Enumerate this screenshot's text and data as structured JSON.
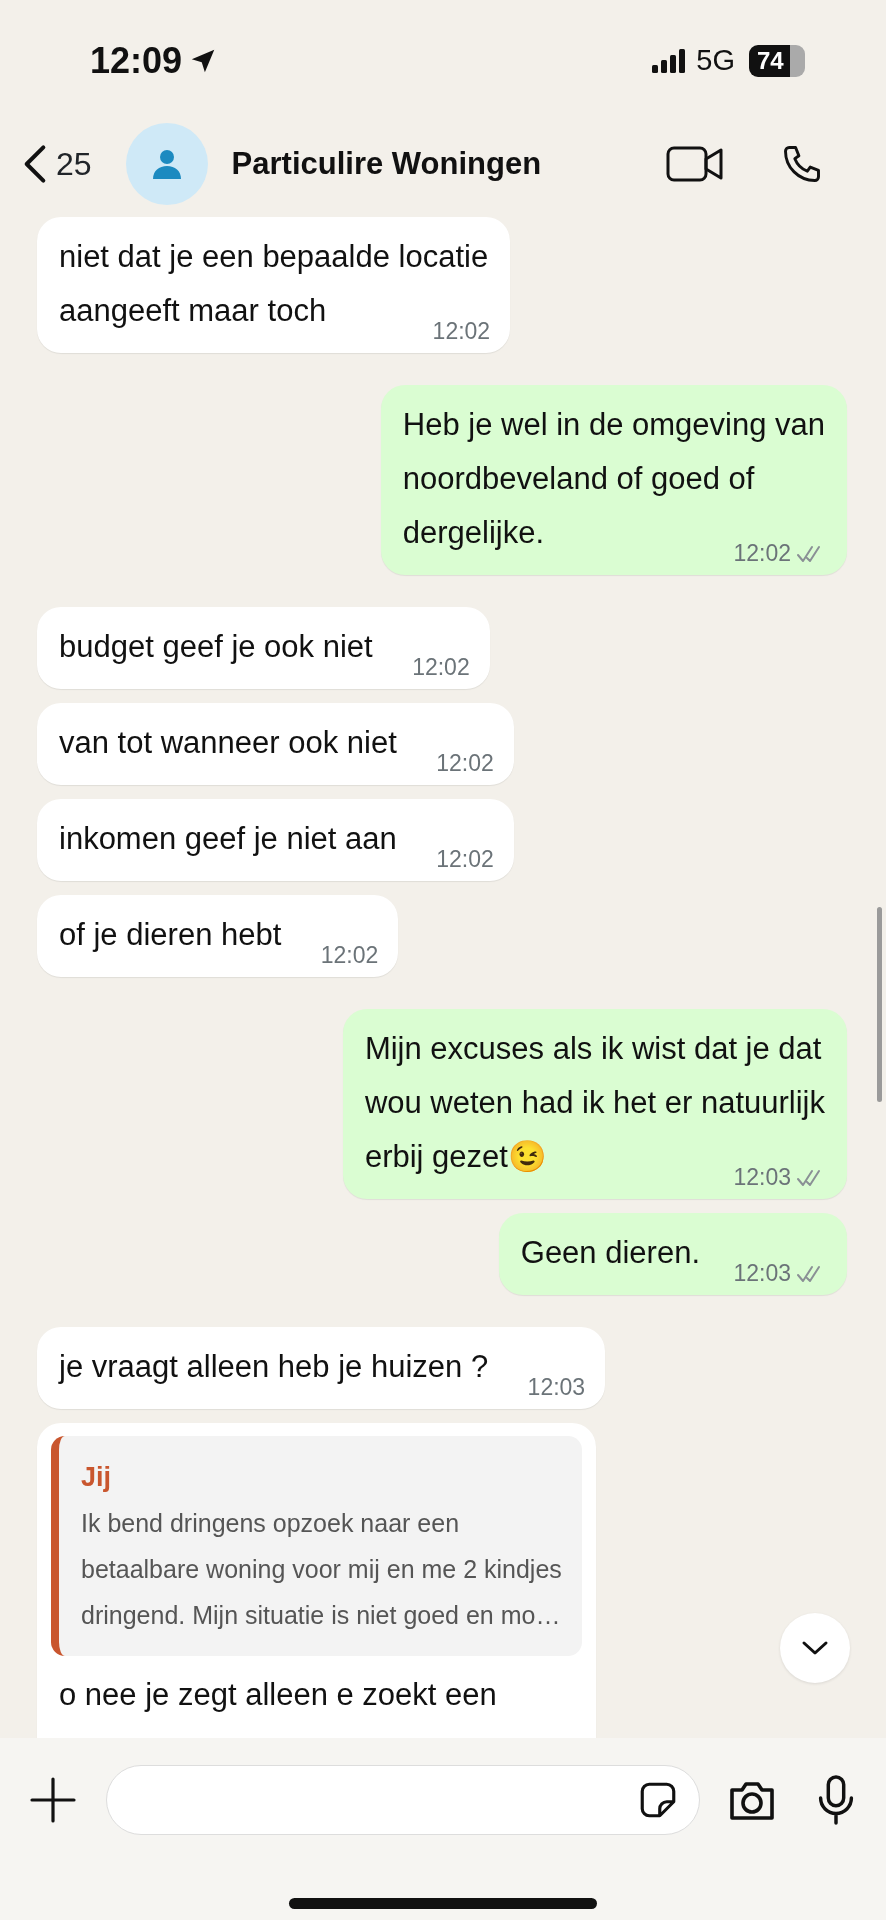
{
  "status_bar": {
    "time": "12:09",
    "network": "5G",
    "battery": "74"
  },
  "header": {
    "back_count": "25",
    "title": "Particulire Woningen"
  },
  "messages": [
    {
      "kind": "incoming",
      "lines": [
        "niet dat je een bepaalde locatie",
        "aangeeft maar toch"
      ],
      "time": "12:02"
    },
    {
      "kind": "outgoing",
      "lines": [
        "Heb je wel in de omgeving van",
        "noordbeveland of goed of",
        "dergelijke."
      ],
      "time": "12:02",
      "read": false
    },
    {
      "kind": "incoming",
      "lines": [
        "budget geef je ook niet"
      ],
      "time": "12:02"
    },
    {
      "kind": "incoming",
      "lines": [
        "van tot wanneer ook niet"
      ],
      "time": "12:02"
    },
    {
      "kind": "incoming",
      "lines": [
        "inkomen geef je niet aan"
      ],
      "time": "12:02"
    },
    {
      "kind": "incoming",
      "lines": [
        "of je dieren hebt"
      ],
      "time": "12:02"
    },
    {
      "kind": "outgoing",
      "lines": [
        "Mijn excuses als ik wist dat je dat",
        "wou weten had ik het er natuurlijk",
        "erbij gezet😉"
      ],
      "time": "12:03",
      "read": false
    },
    {
      "kind": "outgoing",
      "lines": [
        "Geen dieren."
      ],
      "time": "12:03",
      "read": false
    },
    {
      "kind": "incoming",
      "lines": [
        "je vraagt alleen heb je huizen ?"
      ],
      "time": "12:03"
    },
    {
      "kind": "incoming",
      "quote": {
        "author": "Jij",
        "lines": [
          "Ik bend dringens opzoek naar een",
          "betaalbare woning voor mij en me 2 kindjes",
          "dringend. Mijn situatie is niet goed en mo…"
        ]
      },
      "lines": [
        "o nee je zegt alleen e zoekt een"
      ]
    }
  ]
}
